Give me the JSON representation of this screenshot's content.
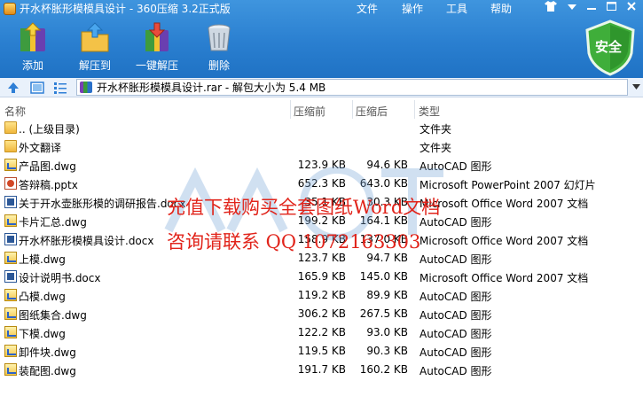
{
  "window": {
    "title": "开水杯胀形模模具设计 - 360压缩 3.2正式版",
    "menu": [
      "文件",
      "操作",
      "工具",
      "帮助"
    ]
  },
  "toolbar": {
    "buttons": [
      {
        "label": "添加",
        "icon": "add-archive-icon"
      },
      {
        "label": "解压到",
        "icon": "extract-to-icon"
      },
      {
        "label": "一键解压",
        "icon": "one-click-extract-icon"
      },
      {
        "label": "删除",
        "icon": "delete-icon"
      }
    ],
    "security_label": "安全"
  },
  "address": {
    "path": "开水杯胀形模模具设计.rar - 解包大小为 5.4 MB"
  },
  "columns": [
    "名称",
    "压缩前",
    "压缩后",
    "类型"
  ],
  "rows": [
    {
      "name": ".. (上级目录)",
      "csize": "",
      "psize": "",
      "type": "文件夹",
      "kind": "folder"
    },
    {
      "name": "外文翻译",
      "csize": "",
      "psize": "",
      "type": "文件夹",
      "kind": "folder"
    },
    {
      "name": "产品图.dwg",
      "csize": "123.9 KB",
      "psize": "94.6 KB",
      "type": "AutoCAD 图形",
      "kind": "dwg"
    },
    {
      "name": "答辩稿.pptx",
      "csize": "652.3 KB",
      "psize": "643.0 KB",
      "type": "Microsoft PowerPoint 2007 幻灯片",
      "kind": "pptx"
    },
    {
      "name": "关于开水壶胀形模的调研报告.docx",
      "csize": "35.1 KB",
      "psize": "30.3 KB",
      "type": "Microsoft Office Word 2007 文档",
      "kind": "docx"
    },
    {
      "name": "卡片汇总.dwg",
      "csize": "199.2 KB",
      "psize": "164.1 KB",
      "type": "AutoCAD 图形",
      "kind": "dwg"
    },
    {
      "name": "开水杯胀形模模具设计.docx",
      "csize": "158.9 KB",
      "psize": "137.0 KB",
      "type": "Microsoft Office Word 2007 文档",
      "kind": "docx"
    },
    {
      "name": "上模.dwg",
      "csize": "123.7 KB",
      "psize": "94.7 KB",
      "type": "AutoCAD 图形",
      "kind": "dwg"
    },
    {
      "name": "设计说明书.docx",
      "csize": "165.9 KB",
      "psize": "145.0 KB",
      "type": "Microsoft Office Word 2007 文档",
      "kind": "docx"
    },
    {
      "name": "凸模.dwg",
      "csize": "119.2 KB",
      "psize": "89.9 KB",
      "type": "AutoCAD 图形",
      "kind": "dwg"
    },
    {
      "name": "图纸集合.dwg",
      "csize": "306.2 KB",
      "psize": "267.5 KB",
      "type": "AutoCAD 图形",
      "kind": "dwg"
    },
    {
      "name": "下模.dwg",
      "csize": "122.2 KB",
      "psize": "93.0 KB",
      "type": "AutoCAD 图形",
      "kind": "dwg"
    },
    {
      "name": "卸件块.dwg",
      "csize": "119.5 KB",
      "psize": "90.3 KB",
      "type": "AutoCAD 图形",
      "kind": "dwg"
    },
    {
      "name": "装配图.dwg",
      "csize": "191.7 KB",
      "psize": "160.2 KB",
      "type": "AutoCAD 图形",
      "kind": "dwg"
    }
  ],
  "watermark": {
    "line1": "充值下载购买全套图纸Word文档",
    "line2": "咨询请联系 QQ 1072163303",
    "color": "#e1241b"
  }
}
